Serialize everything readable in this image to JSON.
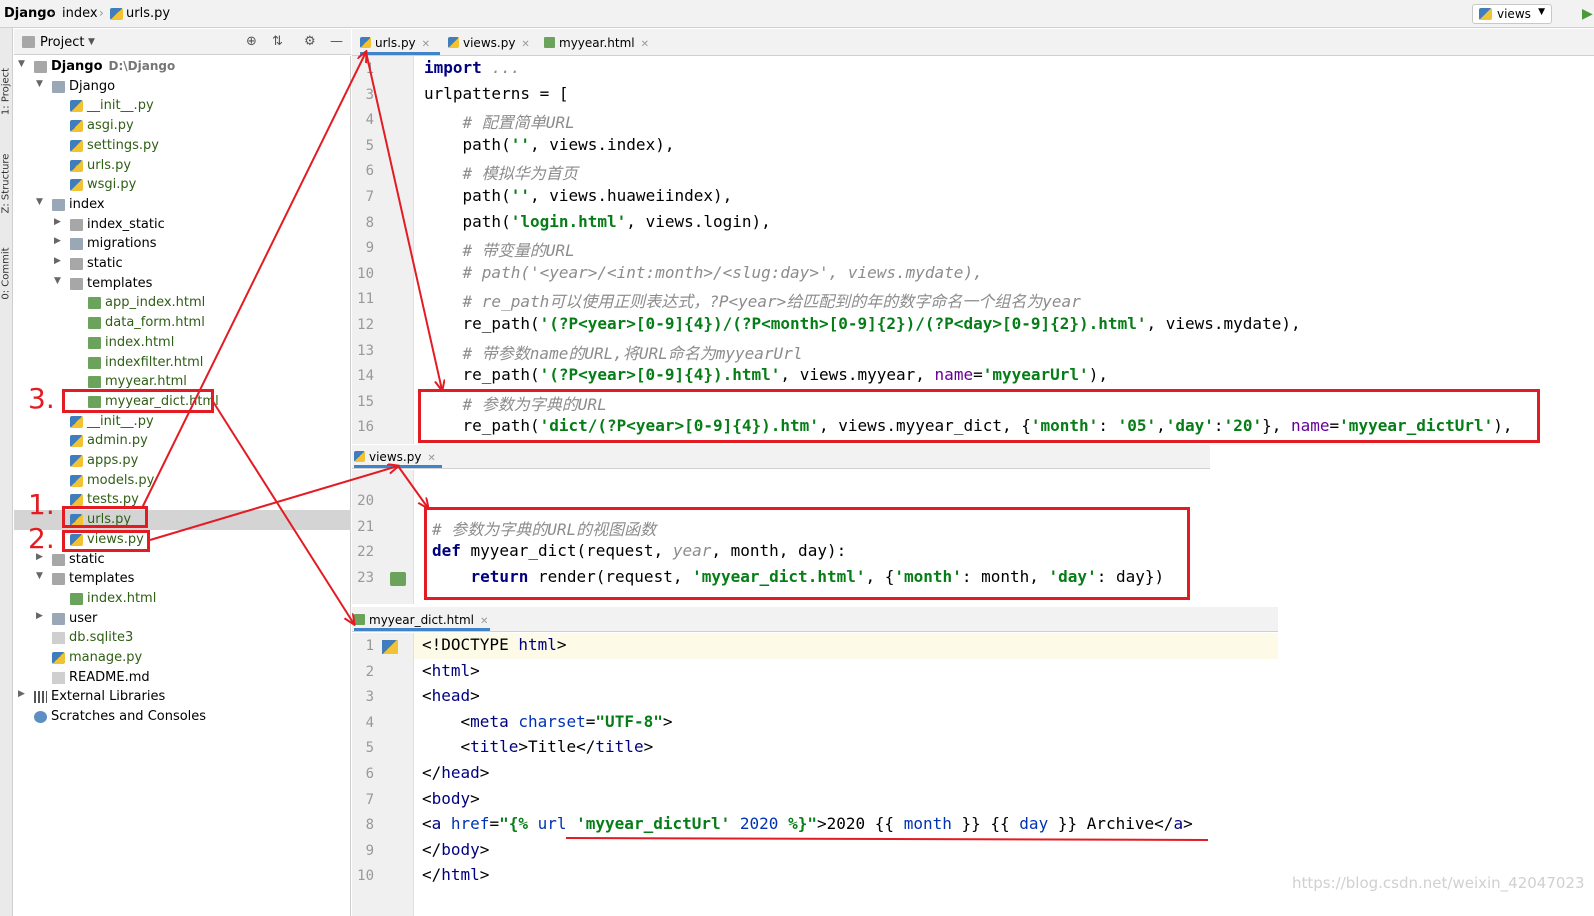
{
  "breadcrumb": {
    "root": "Django",
    "mid": "index",
    "file": "urls.py"
  },
  "run_config": {
    "label": "views"
  },
  "side_tabs": {
    "project": "1: Project",
    "structure": "Z: Structure",
    "commit": "0: Commit"
  },
  "project_panel": {
    "title": "Project"
  },
  "tree": [
    {
      "label": "Django",
      "extra": "D:\\Django",
      "depth": 0,
      "arrow": "open",
      "icon": "folder",
      "kind": "root"
    },
    {
      "label": "Django",
      "depth": 1,
      "arrow": "open",
      "icon": "pkg"
    },
    {
      "label": "__init__.py",
      "depth": 2,
      "icon": "py"
    },
    {
      "label": "asgi.py",
      "depth": 2,
      "icon": "py"
    },
    {
      "label": "settings.py",
      "depth": 2,
      "icon": "py"
    },
    {
      "label": "urls.py",
      "depth": 2,
      "icon": "py"
    },
    {
      "label": "wsgi.py",
      "depth": 2,
      "icon": "py"
    },
    {
      "label": "index",
      "depth": 1,
      "arrow": "open",
      "icon": "pkg"
    },
    {
      "label": "index_static",
      "depth": 2,
      "arrow": "closed",
      "icon": "folder"
    },
    {
      "label": "migrations",
      "depth": 2,
      "arrow": "closed",
      "icon": "pkg"
    },
    {
      "label": "static",
      "depth": 2,
      "arrow": "closed",
      "icon": "folder"
    },
    {
      "label": "templates",
      "depth": 2,
      "arrow": "open",
      "icon": "folder"
    },
    {
      "label": "app_index.html",
      "depth": 3,
      "icon": "html"
    },
    {
      "label": "data_form.html",
      "depth": 3,
      "icon": "html"
    },
    {
      "label": "index.html",
      "depth": 3,
      "icon": "html"
    },
    {
      "label": "indexfilter.html",
      "depth": 3,
      "icon": "html"
    },
    {
      "label": "myyear.html",
      "depth": 3,
      "icon": "html"
    },
    {
      "label": "myyear_dict.html",
      "depth": 3,
      "icon": "html"
    },
    {
      "label": "__init__.py",
      "depth": 2,
      "icon": "py"
    },
    {
      "label": "admin.py",
      "depth": 2,
      "icon": "py"
    },
    {
      "label": "apps.py",
      "depth": 2,
      "icon": "py"
    },
    {
      "label": "models.py",
      "depth": 2,
      "icon": "py"
    },
    {
      "label": "tests.py",
      "depth": 2,
      "icon": "py"
    },
    {
      "label": "urls.py",
      "depth": 2,
      "icon": "py",
      "selected": true
    },
    {
      "label": "views.py",
      "depth": 2,
      "icon": "py"
    },
    {
      "label": "static",
      "depth": 1,
      "arrow": "closed",
      "icon": "folder"
    },
    {
      "label": "templates",
      "depth": 1,
      "arrow": "open",
      "icon": "folder"
    },
    {
      "label": "index.html",
      "depth": 2,
      "icon": "html"
    },
    {
      "label": "user",
      "depth": 1,
      "arrow": "closed",
      "icon": "pkg"
    },
    {
      "label": "db.sqlite3",
      "depth": 1,
      "icon": "file"
    },
    {
      "label": "manage.py",
      "depth": 1,
      "icon": "py"
    },
    {
      "label": "README.md",
      "depth": 1,
      "icon": "file",
      "plain": true
    },
    {
      "label": "External Libraries",
      "depth": 0,
      "arrow": "closed",
      "icon": "lib",
      "plain": true
    },
    {
      "label": "Scratches and Consoles",
      "depth": 0,
      "icon": "scr",
      "plain": true
    }
  ],
  "annotations": {
    "n1": "1.",
    "n2": "2.",
    "n3": "3."
  },
  "editor1": {
    "tabs": [
      "urls.py",
      "views.py",
      "myyear.html"
    ],
    "line_numbers": [
      "1",
      "3",
      "4",
      "5",
      "6",
      "7",
      "8",
      "9",
      "10",
      "11",
      "12",
      "13",
      "14",
      "15",
      "16"
    ],
    "lines": [
      [
        [
          "kw",
          "import "
        ],
        [
          "cm",
          "..."
        ]
      ],
      [
        [
          "",
          "urlpatterns = ["
        ]
      ],
      [
        [
          "cm",
          "    # 配置简单URL"
        ]
      ],
      [
        [
          "",
          "    path("
        ],
        [
          "str",
          "''"
        ],
        [
          "",
          ", views.index),"
        ]
      ],
      [
        [
          "cm",
          "    # 模拟华为首页"
        ]
      ],
      [
        [
          "",
          "    path("
        ],
        [
          "str",
          "''"
        ],
        [
          "",
          ", views.huaweiindex),"
        ]
      ],
      [
        [
          "",
          "    path("
        ],
        [
          "str",
          "'login.html'"
        ],
        [
          "",
          ", views.login),"
        ]
      ],
      [
        [
          "cm",
          "    # 带变量的URL"
        ]
      ],
      [
        [
          "cm",
          "    # path('<year>/<int:month>/<slug:day>', views.mydate),"
        ]
      ],
      [
        [
          "cm",
          "    # re_path可以使用正则表达式，?P<year>给匹配到的年的数字命名一个组名为year"
        ]
      ],
      [
        [
          "",
          "    re_path("
        ],
        [
          "str",
          "'(?P<year>[0-9]{4})/(?P<month>[0-9]{2})/(?P<day>[0-9]{2}).html'"
        ],
        [
          "",
          ", views.mydate),"
        ]
      ],
      [
        [
          "cm",
          "    # 带参数name的URL,将URL命名为myyearUrl"
        ]
      ],
      [
        [
          "",
          "    re_path("
        ],
        [
          "str",
          "'(?P<year>[0-9]{4}).html'"
        ],
        [
          "",
          ", views.myyear, "
        ],
        [
          "par",
          "name"
        ],
        [
          "",
          "="
        ],
        [
          "str",
          "'myyearUrl'"
        ],
        [
          "",
          "),"
        ]
      ],
      [
        [
          "cm",
          "    # 参数为字典的URL"
        ]
      ],
      [
        [
          "",
          "    re_path("
        ],
        [
          "str",
          "'dict/(?P<year>[0-9]{4}).htm'"
        ],
        [
          "",
          ", views.myyear_dict, {"
        ],
        [
          "str",
          "'month'"
        ],
        [
          "",
          ": "
        ],
        [
          "str",
          "'05'"
        ],
        [
          "",
          ","
        ],
        [
          "str",
          "'day'"
        ],
        [
          "",
          ":"
        ],
        [
          "str",
          "'20'"
        ],
        [
          "",
          "}, "
        ],
        [
          "par",
          "name"
        ],
        [
          "",
          "="
        ],
        [
          "str",
          "'myyear_dictUrl'"
        ],
        [
          "",
          "),"
        ]
      ]
    ]
  },
  "editor2": {
    "tab": "views.py",
    "line_numbers": [
      "20",
      "21",
      "22",
      "23"
    ],
    "lines": [
      [
        [
          "",
          ""
        ]
      ],
      [
        [
          "cm",
          "# 参数为字典的URL的视图函数"
        ]
      ],
      [
        [
          "kw",
          "def "
        ],
        [
          "",
          "myyear_dict(request, "
        ],
        [
          "cm",
          "year"
        ],
        [
          "",
          ", month, day):"
        ]
      ],
      [
        [
          "kw",
          "    return "
        ],
        [
          "",
          "render(request, "
        ],
        [
          "str",
          "'myyear_dict.html'"
        ],
        [
          "",
          ", {"
        ],
        [
          "str",
          "'month'"
        ],
        [
          "",
          ": month, "
        ],
        [
          "str",
          "'day'"
        ],
        [
          "",
          ": day})"
        ]
      ]
    ]
  },
  "editor3": {
    "tab": "myyear_dict.html",
    "line_numbers": [
      "1",
      "2",
      "3",
      "4",
      "5",
      "6",
      "7",
      "8",
      "9",
      "10"
    ],
    "lines": [
      [
        [
          "",
          "<!DOCTYPE "
        ],
        [
          "tag",
          "html"
        ],
        [
          "",
          ">"
        ]
      ],
      [
        [
          "",
          "<"
        ],
        [
          "tag",
          "html"
        ],
        [
          "",
          ">"
        ]
      ],
      [
        [
          "",
          "<"
        ],
        [
          "tag",
          "head"
        ],
        [
          "",
          ">"
        ]
      ],
      [
        [
          "",
          "    <"
        ],
        [
          "tag",
          "meta "
        ],
        [
          "attr",
          "charset"
        ],
        [
          "",
          "="
        ],
        [
          "str",
          "\"UTF-8\""
        ],
        [
          "",
          ">"
        ]
      ],
      [
        [
          "",
          "    <"
        ],
        [
          "tag",
          "title"
        ],
        [
          "",
          ">Title</"
        ],
        [
          "tag",
          "title"
        ],
        [
          "",
          ">"
        ]
      ],
      [
        [
          "",
          "</"
        ],
        [
          "tag",
          "head"
        ],
        [
          "",
          ">"
        ]
      ],
      [
        [
          "",
          "<"
        ],
        [
          "tag",
          "body"
        ],
        [
          "",
          ">"
        ]
      ],
      [
        [
          "",
          "<"
        ],
        [
          "tag",
          "a "
        ],
        [
          "attr",
          "href"
        ],
        [
          "",
          "="
        ],
        [
          "str",
          "\"{% "
        ],
        [
          "attr",
          "url "
        ],
        [
          "str",
          "'myyear_dictUrl' "
        ],
        [
          "attr",
          "2020 "
        ],
        [
          "str",
          "%}\""
        ],
        [
          "",
          ">2020 {{ "
        ],
        [
          "attr",
          "month"
        ],
        [
          "",
          " }} {{ "
        ],
        [
          "attr",
          "day"
        ],
        [
          "",
          " }} Archive</"
        ],
        [
          "tag",
          "a"
        ],
        [
          "",
          ">"
        ]
      ],
      [
        [
          "",
          "</"
        ],
        [
          "tag",
          "body"
        ],
        [
          "",
          ">"
        ]
      ],
      [
        [
          "",
          "</"
        ],
        [
          "tag",
          "html"
        ],
        [
          "",
          ">"
        ]
      ]
    ]
  },
  "watermark": "https://blog.csdn.net/weixin_42047023",
  "colors": {
    "annotation_red": "#e31b23",
    "selection": "#d4d4d4",
    "tab_underline": "#4083c9"
  }
}
